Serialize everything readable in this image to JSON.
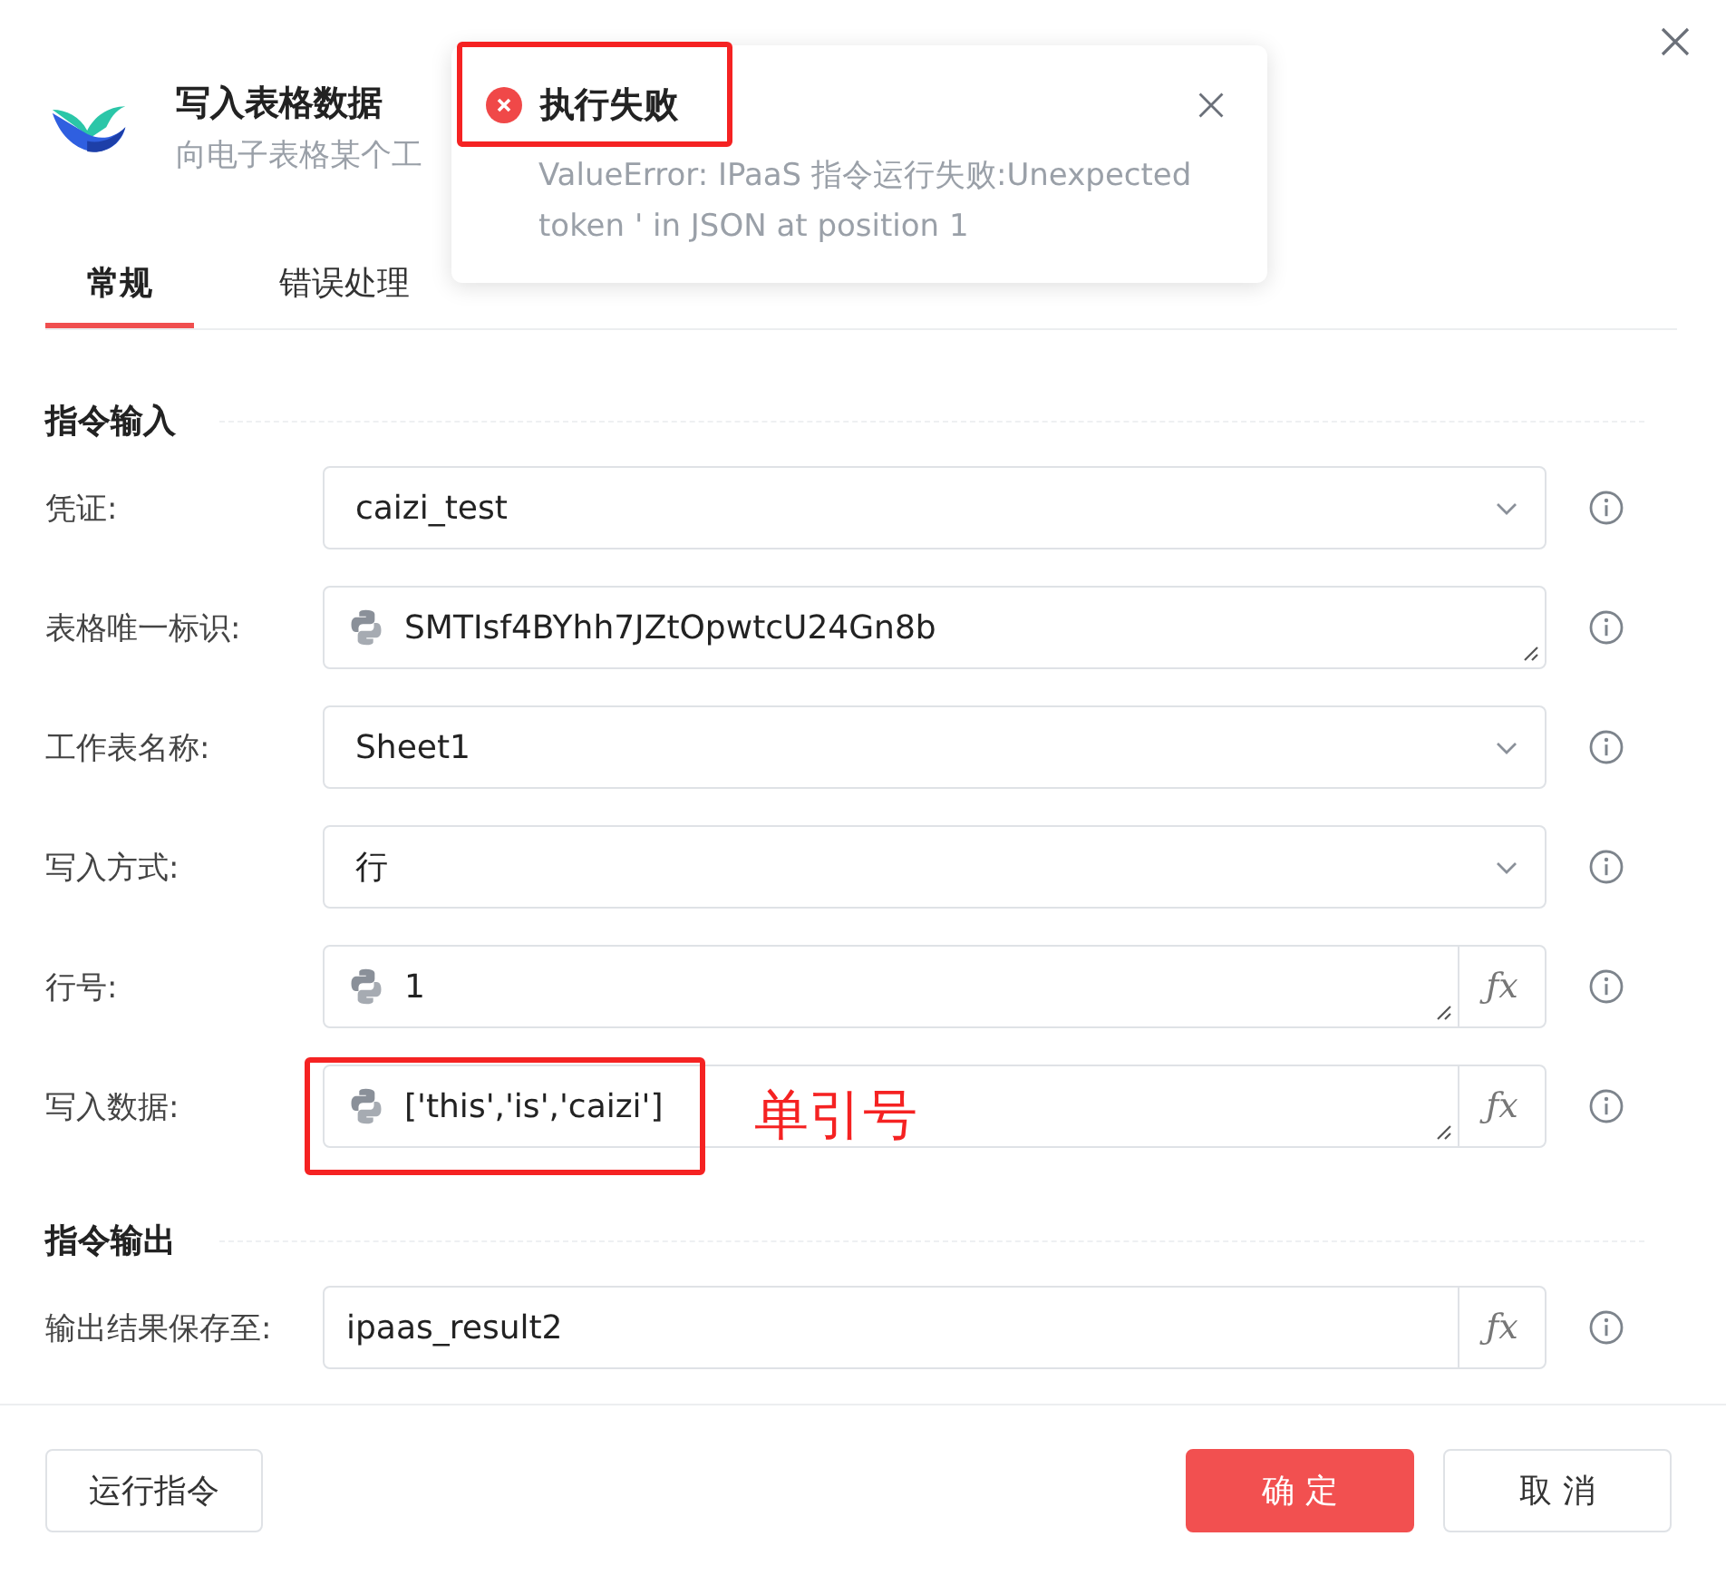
{
  "header": {
    "title": "写入表格数据",
    "subtitle": "向电子表格某个工"
  },
  "tabs": [
    {
      "label": "常规",
      "selected": true
    },
    {
      "label": "错误处理",
      "selected": false
    }
  ],
  "sections": [
    {
      "title": "指令输入",
      "fields": [
        {
          "label": "凭证:",
          "kind": "select",
          "value": "caizi_test"
        },
        {
          "label": "表格唯一标识:",
          "kind": "code",
          "value": "SMTIsf4BYhh7JZtOpwtcU24Gn8b"
        },
        {
          "label": "工作表名称:",
          "kind": "select",
          "value": "Sheet1"
        },
        {
          "label": "写入方式:",
          "kind": "select",
          "value": "行"
        },
        {
          "label": "行号:",
          "kind": "code_fx",
          "value": "1",
          "fx_button": "ƒx"
        },
        {
          "label": "写入数据:",
          "kind": "code_fx",
          "value": "['this','is','caizi']",
          "fx_button": "ƒx"
        }
      ]
    },
    {
      "title": "指令输出",
      "fields": [
        {
          "label": "输出结果保存至:",
          "kind": "fx",
          "value": "ipaas_result2",
          "fx_button": "ƒx"
        }
      ]
    }
  ],
  "footer": {
    "run_button": "运行指令",
    "ok_button": "确 定",
    "cancel_button": "取 消"
  },
  "toast": {
    "title": "执行失败",
    "message": "ValueError: IPaaS 指令运行失败:Unexpected token ' in JSON at position 1"
  },
  "annotation": {
    "note": "单引号"
  }
}
